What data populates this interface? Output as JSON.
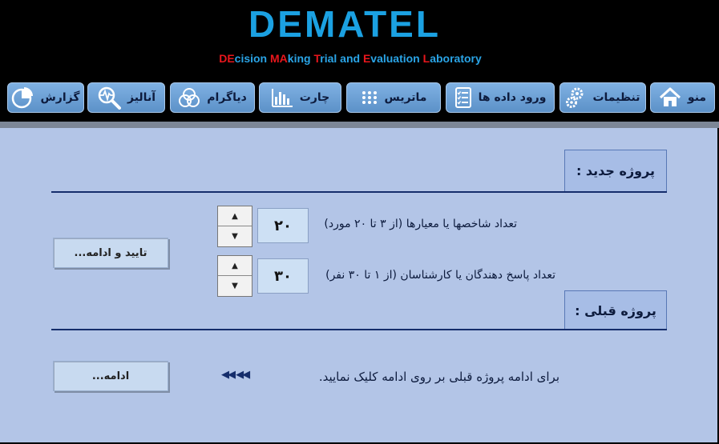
{
  "header": {
    "logo_title": "DEMATEL",
    "subtitle_segments": [
      {
        "text": "DE",
        "color": "red"
      },
      {
        "text": "cision ",
        "color": "blue"
      },
      {
        "text": "MA",
        "color": "red"
      },
      {
        "text": "king ",
        "color": "blue"
      },
      {
        "text": "T",
        "color": "red"
      },
      {
        "text": "rial and ",
        "color": "blue"
      },
      {
        "text": "E",
        "color": "red"
      },
      {
        "text": "valuation ",
        "color": "blue"
      },
      {
        "text": "L",
        "color": "red"
      },
      {
        "text": "aboratory",
        "color": "blue"
      }
    ]
  },
  "nav": {
    "menu": {
      "label": "منو",
      "icon": "home-icon"
    },
    "settings": {
      "label": "تنظیمات",
      "icon": "gears-icon"
    },
    "data_entry": {
      "label": "ورود داده ها",
      "icon": "form-icon"
    },
    "matrix": {
      "label": "ماتریس",
      "icon": "grid-dots-icon"
    },
    "chart": {
      "label": "چارت",
      "icon": "bar-chart-icon"
    },
    "diagram": {
      "label": "دیاگرام",
      "icon": "venn-icon"
    },
    "analysis": {
      "label": "آنالیز",
      "icon": "magnifier-pulse-icon"
    },
    "report": {
      "label": "گزارش",
      "icon": "pie-chart-icon"
    }
  },
  "new_project": {
    "title": "پروژه جدید :",
    "criteria_label": "تعداد شاخصها یا معیارها (از ۳ تا ۲۰ مورد)",
    "criteria_value": "۲۰",
    "respondents_label": "تعداد پاسخ دهندگان یا کارشناسان (از ۱ تا  ۳۰  نفر)",
    "respondents_value": "۳۰",
    "confirm_button": "تایید و ادامه..."
  },
  "previous_project": {
    "title": "پروژه قبلی :",
    "instruction": "برای ادامه پروژه قبلی بر روی ادامه کلیک نمایید.",
    "arrows": "◀◀  ◀◀",
    "continue_button": "ادامه..."
  },
  "colors": {
    "logo": "#1ba1e2",
    "subtitle_red": "#e8161c",
    "subtitle_blue": "#2aa4e6",
    "nav_button": "#6a9fd5",
    "panel_background": "#b3c5e7",
    "divider": "#152d6b"
  }
}
